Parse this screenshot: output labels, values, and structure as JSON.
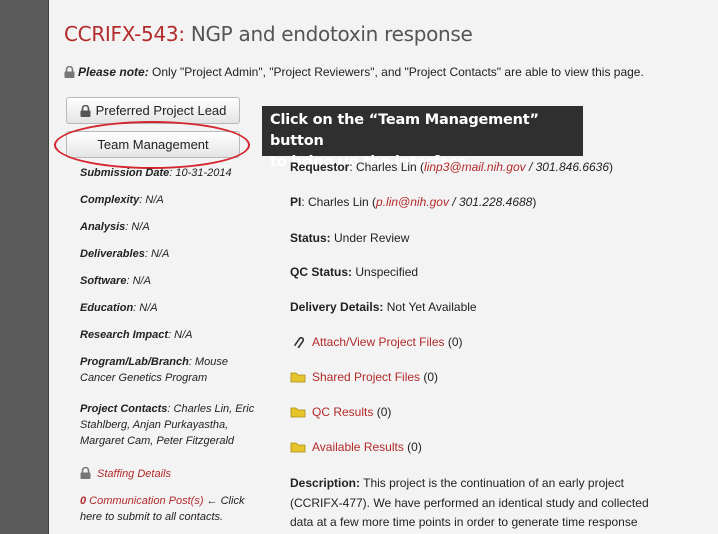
{
  "header": {
    "project_id": "CCRIFX-543:",
    "project_title": " NGP and endotoxin response"
  },
  "note": {
    "label": "Please note:",
    "text": " Only \"Project Admin\", \"Project Reviewers\", and \"Project Contacts\" are able to view this page."
  },
  "buttons": {
    "preferred_lead": "Preferred Project Lead",
    "team_management": "Team Management"
  },
  "callout": {
    "line1": "Click on the “Team Management” button",
    "line2": "to bring up the interface."
  },
  "left": {
    "submission": {
      "label": "Submission Date",
      "value": ": 10-31-2014"
    },
    "complexity": {
      "label": "Complexity",
      "value": ": N/A"
    },
    "analysis": {
      "label": "Analysis",
      "value": ": N/A"
    },
    "deliverables": {
      "label": "Deliverables",
      "value": ": N/A"
    },
    "software": {
      "label": "Software",
      "value": ": N/A"
    },
    "education": {
      "label": "Education",
      "value": ": N/A"
    },
    "impact": {
      "label": "Research Impact",
      "value": ": N/A"
    },
    "program": {
      "label": "Program/Lab/Branch",
      "value": ": Mouse Cancer Genetics Program"
    },
    "contacts": {
      "label": "Project Contacts",
      "value": ": Charles Lin, Eric Stahlberg, Anjan Purkayastha, Margaret Cam, Peter Fitzgerald"
    },
    "staffing": "Staffing Details",
    "comm_count": "0",
    "comm_link": " Communication Post(s)",
    "comm_text": " ← Click here to submit to all contacts."
  },
  "right": {
    "requestor": {
      "label": "Requestor",
      "name": ": Charles Lin (",
      "email": "linp3@mail.nih.gov",
      "phone": " / 301.846.6636",
      "close": ")"
    },
    "pi": {
      "label": "PI",
      "name": ": Charles Lin (",
      "email": "p.lin@nih.gov",
      "phone": " / 301.228.4688",
      "close": ")"
    },
    "status": {
      "label": "Status:",
      "value": " Under Review"
    },
    "qc_status": {
      "label": "QC Status:",
      "value": " Unspecified"
    },
    "delivery": {
      "label": "Delivery Details:",
      "value": " Not Yet Available"
    },
    "attach": {
      "link": "Attach/View Project Files",
      "count": " (0)"
    },
    "shared": {
      "link": "Shared Project Files",
      "count": " (0)"
    },
    "qc_results": {
      "link": "QC Results",
      "count": " (0)"
    },
    "available": {
      "link": "Available Results",
      "count": " (0)"
    },
    "description": {
      "label": "Description:",
      "text": " This project is the continuation of an early project (CCRIFX-477). We have performed an identical study and collected data at a few more time points in order to generate time response"
    }
  },
  "colors": {
    "accent": "#b22a2a",
    "highlight": "#d3262e",
    "callout_bg": "#2f2f2f"
  },
  "icons": [
    "lock-icon",
    "paperclip-icon",
    "folder-icon"
  ]
}
